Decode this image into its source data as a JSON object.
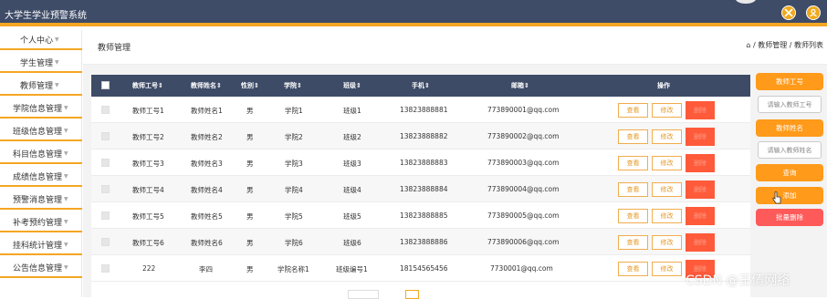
{
  "app": {
    "title": "大学生学业预警系统"
  },
  "header_icons": {
    "fullscreen_icon": "expand-arrows",
    "user_icon": "user"
  },
  "sidebar": {
    "items": [
      {
        "label": "个人中心"
      },
      {
        "label": "学生管理"
      },
      {
        "label": "教师管理"
      },
      {
        "label": "学院信息管理"
      },
      {
        "label": "班级信息管理"
      },
      {
        "label": "科目信息管理"
      },
      {
        "label": "成绩信息管理"
      },
      {
        "label": "预警消息管理"
      },
      {
        "label": "补考预约管理"
      },
      {
        "label": "挂科统计管理"
      },
      {
        "label": "公告信息管理"
      }
    ]
  },
  "page": {
    "title": "教师管理",
    "breadcrumb": "⌂ / 教师管理 / 教师列表"
  },
  "table": {
    "headers": [
      "教师工号⇕",
      "教师姓名⇕",
      "性别⇕",
      "学院⇕",
      "班级⇕",
      "手机⇕",
      "邮箱⇕",
      "操作"
    ],
    "rows": [
      {
        "id": "教师工号1",
        "name": "教师姓名1",
        "gender": "男",
        "college": "学院1",
        "class": "班级1",
        "phone": "13823888881",
        "email": "773890001@qq.com"
      },
      {
        "id": "教师工号2",
        "name": "教师姓名2",
        "gender": "男",
        "college": "学院2",
        "class": "班级2",
        "phone": "13823888882",
        "email": "773890002@qq.com"
      },
      {
        "id": "教师工号3",
        "name": "教师姓名3",
        "gender": "男",
        "college": "学院3",
        "class": "班级3",
        "phone": "13823888883",
        "email": "773890003@qq.com"
      },
      {
        "id": "教师工号4",
        "name": "教师姓名4",
        "gender": "男",
        "college": "学院4",
        "class": "班级4",
        "phone": "13823888884",
        "email": "773890004@qq.com"
      },
      {
        "id": "教师工号5",
        "name": "教师姓名5",
        "gender": "男",
        "college": "学院5",
        "class": "班级5",
        "phone": "13823888885",
        "email": "773890005@qq.com"
      },
      {
        "id": "教师工号6",
        "name": "教师姓名6",
        "gender": "男",
        "college": "学院6",
        "class": "班级6",
        "phone": "13823888886",
        "email": "773890006@qq.com"
      },
      {
        "id": "222",
        "name": "李四",
        "gender": "男",
        "college": "学院名称1",
        "class": "班级编号1",
        "phone": "18154565456",
        "email": "7730001@qq.com"
      }
    ],
    "actions": {
      "view": "查看",
      "edit": "修改",
      "delete": "删除"
    }
  },
  "search_panel": {
    "teacher_id_label": "教师工号",
    "teacher_id_placeholder": "请输入教师工号",
    "teacher_name_label": "教师姓名",
    "teacher_name_placeholder": "请输入教师姓名",
    "query_button": "查询",
    "add_button": "添加",
    "batch_delete_button": "批量删除"
  },
  "watermark": "CSDN @王倩网络",
  "colors": {
    "topbar": "#3f4c68",
    "accent": "#f5a623",
    "table_header": "#3e4b67",
    "button_orange": "#ff9a1a",
    "button_red": "#ff5a5a",
    "delete_red": "#ff5a3a"
  }
}
